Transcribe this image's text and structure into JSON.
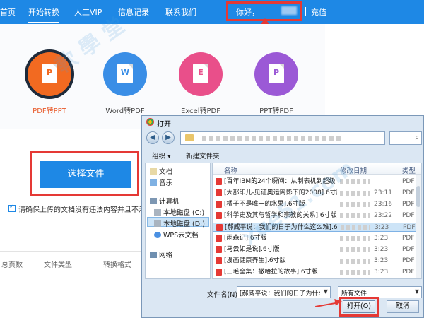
{
  "nav": {
    "items": [
      "首页",
      "开始转换",
      "人工VIP",
      "信息记录",
      "联系我们"
    ],
    "greeting": "你好，",
    "recharge": "充值"
  },
  "converters": [
    {
      "label": "PDF转PPT",
      "letter": "P",
      "color": "#f26a21",
      "active": true
    },
    {
      "label": "Word转PDF",
      "letter": "W",
      "color": "#3a8ee6",
      "active": false
    },
    {
      "label": "Excel转PDF",
      "letter": "E",
      "color": "#e94f8a",
      "active": false
    },
    {
      "label": "PPT转PDF",
      "letter": "P",
      "color": "#9b59d6",
      "active": false
    }
  ],
  "main": {
    "choose_file": "选择文件",
    "agree_text": "请确保上传的文档没有违法内容并且不涉",
    "table_headers": [
      "总页数",
      "文件类型",
      "转换格式"
    ]
  },
  "dialog": {
    "title": "打开",
    "toolbar": {
      "organize": "组织 ▾",
      "new_folder": "新建文件夹"
    },
    "nav_pane": [
      "文档",
      "音乐",
      "计算机",
      "本地磁盘 (C:)",
      "本地磁盘 (D:)",
      "WPS云文档",
      "网络"
    ],
    "columns": {
      "name": "名称",
      "date": "修改日期",
      "type": "类型"
    },
    "files": [
      {
        "name": "[百年IBM的24个瞬间：从制表机到超级",
        "date": "",
        "type": "PDF"
      },
      {
        "name": "[大部印儿-见证奥运网影下的2008].6寸版",
        "date": "23:11",
        "type": "PDF"
      },
      {
        "name": "[橘子不是唯一的水果].6寸版",
        "date": "23:16",
        "type": "PDF"
      },
      {
        "name": "[科学史及其与哲学和宗教的关系].6寸版",
        "date": "23:22",
        "type": "PDF"
      },
      {
        "name": "[郝威平说：我们的日子为什么这么难].6...",
        "date": "3:23",
        "type": "PDF"
      },
      {
        "name": "[雨森记].6寸版",
        "date": "3:23",
        "type": "PDF"
      },
      {
        "name": "[马云如是说].6寸版",
        "date": "3:23",
        "type": "PDF"
      },
      {
        "name": "[漫画健康养生].6寸版",
        "date": "3:23",
        "type": "PDF"
      },
      {
        "name": "[三毛全集：撒哈拉的故事].6寸版",
        "date": "3:23",
        "type": "PDF"
      }
    ],
    "selected_index": 4,
    "filename_label": "文件名(N):",
    "filename_value": "[郝威平说：我们的日子为什么这么难",
    "filetype_value": "所有文件",
    "open": "打开(O)",
    "cancel": "取消"
  },
  "colors": {
    "nav_blue": "#1e88e5",
    "highlight_red": "#e53935"
  }
}
